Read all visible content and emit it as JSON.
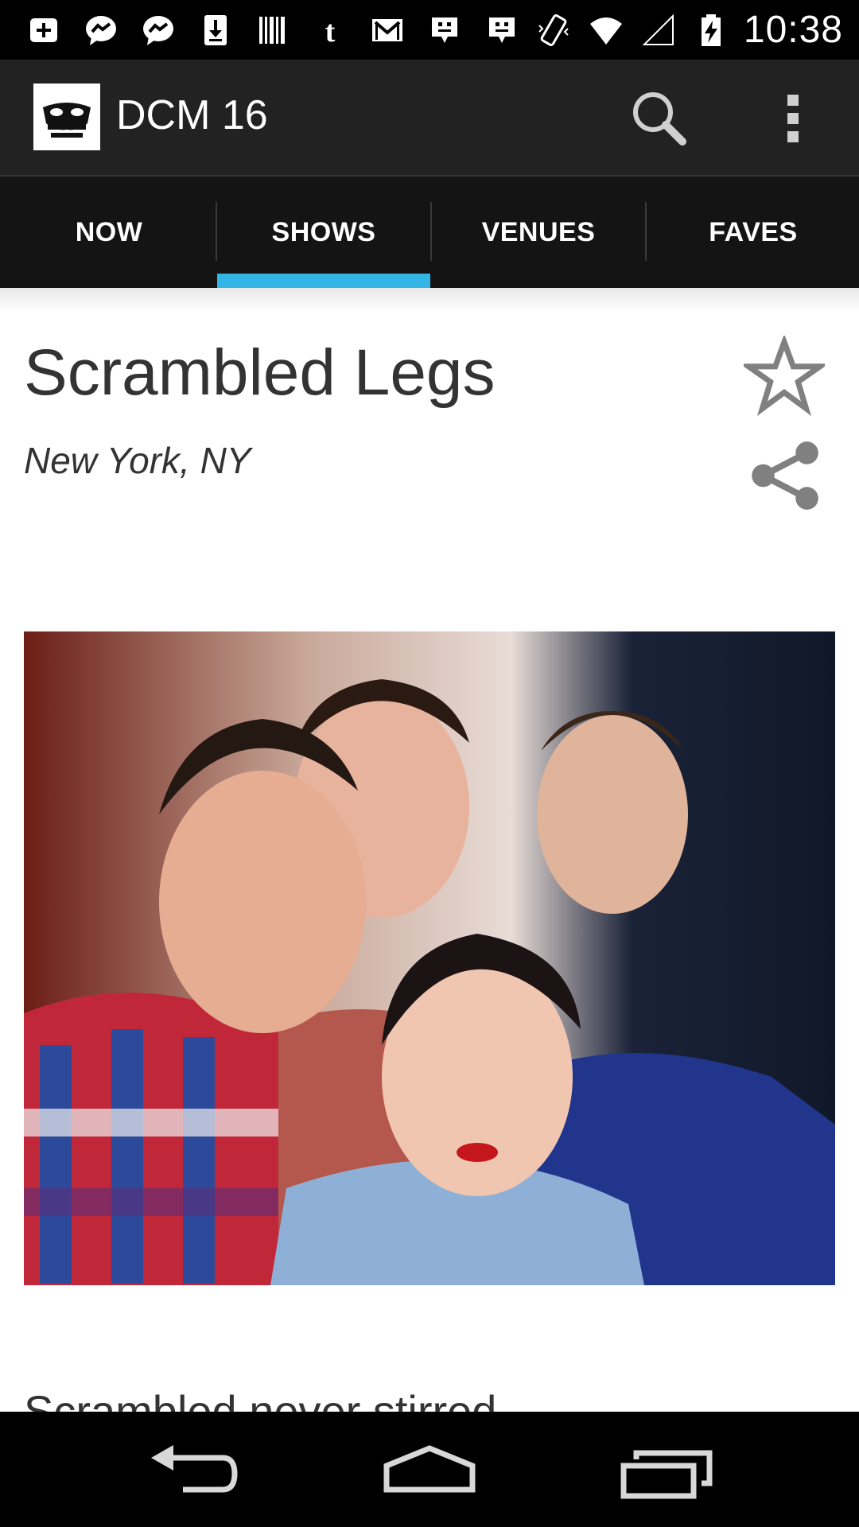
{
  "status_bar": {
    "time": "10:38",
    "notification_icons": [
      "plus-box-icon",
      "messenger-icon",
      "messenger-icon",
      "download-icon",
      "barcode-icon",
      "tumblr-icon",
      "gmail-icon",
      "bbm-icon",
      "bbm-icon"
    ],
    "system_icons": [
      "vibrate-icon",
      "wifi-icon",
      "signal-icon",
      "battery-charging-icon"
    ]
  },
  "action_bar": {
    "title": "DCM 16",
    "icons": [
      "app-logo",
      "search-icon",
      "overflow-menu-icon"
    ]
  },
  "tabs": [
    {
      "label": "NOW",
      "selected": false
    },
    {
      "label": "SHOWS",
      "selected": true
    },
    {
      "label": "VENUES",
      "selected": false
    },
    {
      "label": "FAVES",
      "selected": false
    }
  ],
  "show": {
    "title": "Scrambled Legs",
    "location": "New York, NY",
    "description_partial": "Scrambled never stirred"
  },
  "colors": {
    "accent": "#33b5e5",
    "action_bar": "#222222",
    "tab_bar": "#141414",
    "text": "#333333",
    "icon_gray": "#808080"
  },
  "nav_bar": {
    "buttons": [
      "back-icon",
      "home-icon",
      "recents-icon"
    ]
  }
}
